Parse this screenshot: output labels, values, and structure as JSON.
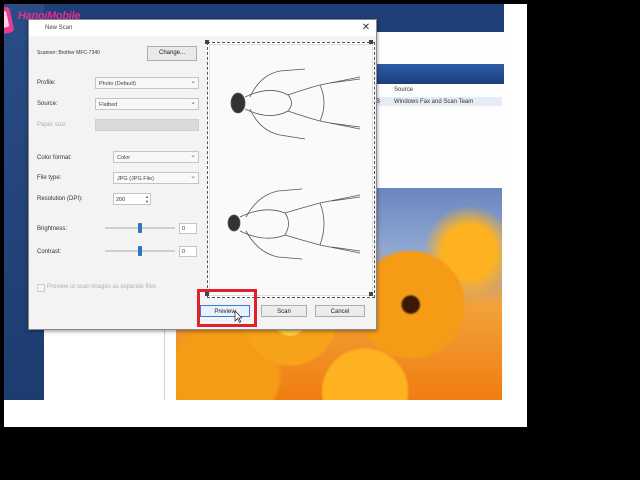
{
  "background_app": {
    "column_source": "Source",
    "row_size": "KB",
    "row_source": "Windows Fax and Scan Team"
  },
  "watermark": {
    "text": "HanoiMobile"
  },
  "dialog": {
    "title": "New Scan",
    "scanner_label": "Scanner: Brother MFC-7340",
    "change_button": "Change...",
    "profile": {
      "label": "Profile:",
      "value": "Photo (Default)"
    },
    "source": {
      "label": "Source:",
      "value": "Flatbed"
    },
    "paper_size": {
      "label": "Paper size:",
      "value": ""
    },
    "color_format": {
      "label": "Color format:",
      "value": "Color"
    },
    "file_type": {
      "label": "File type:",
      "value": "JPG (JPG File)"
    },
    "resolution": {
      "label": "Resolution (DPI):",
      "value": "200"
    },
    "brightness": {
      "label": "Brightness:",
      "value": "0",
      "level": 0.5
    },
    "contrast": {
      "label": "Contrast:",
      "value": "0",
      "level": 0.5
    },
    "preview_checkbox": "Preview or scan images as separate files",
    "buttons": {
      "preview": "Preview",
      "scan": "Scan",
      "cancel": "Cancel"
    }
  }
}
